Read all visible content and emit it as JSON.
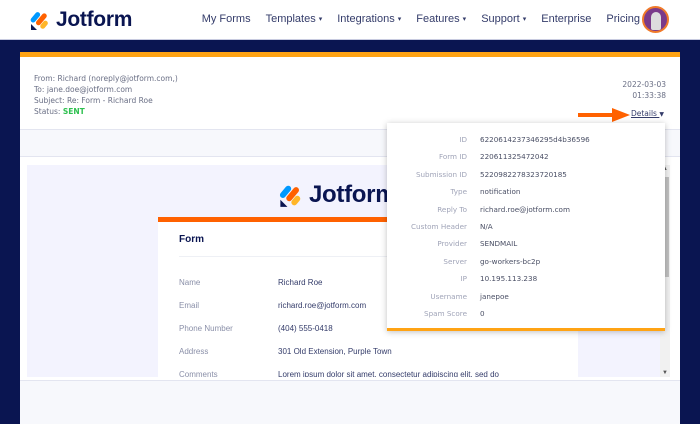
{
  "brand": {
    "name": "Jotform"
  },
  "nav": {
    "items": [
      {
        "label": "My Forms",
        "caret": false
      },
      {
        "label": "Templates",
        "caret": true
      },
      {
        "label": "Integrations",
        "caret": true
      },
      {
        "label": "Features",
        "caret": true
      },
      {
        "label": "Support",
        "caret": true
      },
      {
        "label": "Enterprise",
        "caret": false
      },
      {
        "label": "Pricing",
        "caret": false
      }
    ]
  },
  "email": {
    "from_label": "From:",
    "from": "Richard (noreply@jotform.com,)",
    "to_label": "To:",
    "to": "jane.doe@jotform.com",
    "subject_label": "Subject:",
    "subject": "Re: Form - Richard Roe",
    "status_label": "Status:",
    "status": "SENT",
    "date": "2022-03-03",
    "time": "01:33:38",
    "details_label": "Details"
  },
  "form": {
    "title": "Form",
    "rows": [
      {
        "k": "Name",
        "v": "Richard Roe"
      },
      {
        "k": "Email",
        "v": "richard.roe@jotform.com"
      },
      {
        "k": "Phone Number",
        "v": "(404) 555-0418"
      },
      {
        "k": "Address",
        "v": "301 Old Extension, Purple Town"
      },
      {
        "k": "Comments",
        "v": "Lorem ipsum dolor sit amet, consectetur adipiscing elit, sed do"
      }
    ]
  },
  "details": [
    {
      "k": "ID",
      "v": "6220614237346295d4b36596"
    },
    {
      "k": "Form ID",
      "v": "220611325472042"
    },
    {
      "k": "Submission ID",
      "v": "5220982278323720185"
    },
    {
      "k": "Type",
      "v": "notification"
    },
    {
      "k": "Reply To",
      "v": "richard.roe@jotform.com"
    },
    {
      "k": "Custom Header",
      "v": "N/A"
    },
    {
      "k": "Provider",
      "v": "SENDMAIL"
    },
    {
      "k": "Server",
      "v": "go-workers-bc2p"
    },
    {
      "k": "IP",
      "v": "10.195.113.238"
    },
    {
      "k": "Username",
      "v": "janepoe"
    },
    {
      "k": "Spam Score",
      "v": "0"
    }
  ],
  "colors": {
    "navy": "#0a1551",
    "orange": "#ff6100",
    "amber": "#ffa314",
    "green": "#2ec04f"
  }
}
